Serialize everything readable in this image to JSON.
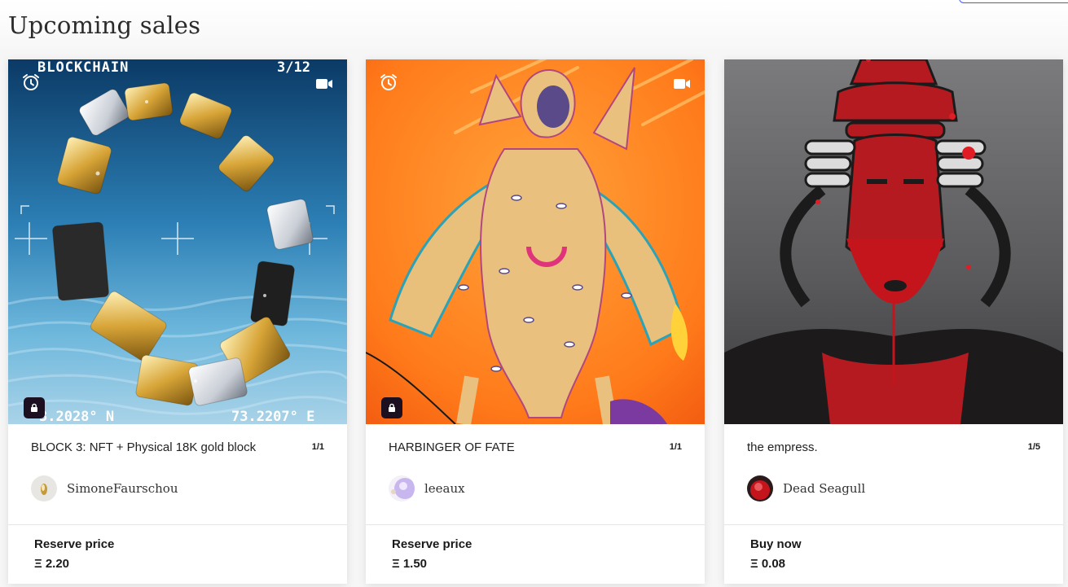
{
  "section": {
    "title": "Upcoming sales"
  },
  "cards": [
    {
      "art_text": {
        "top_left": "BLOCKCHAIN",
        "top_right": "3/12",
        "bottom_left": "3.2028° N",
        "bottom_right": "73.2207° E"
      },
      "title": "BLOCK 3: NFT + Physical 18K gold block",
      "edition": "1/1",
      "creator": "SimoneFaurschou",
      "price_label": "Reserve price",
      "price_value": "Ξ 2.20",
      "icons": [
        "alarm-icon",
        "video-icon",
        "lock-icon"
      ]
    },
    {
      "title": "HARBINGER OF FATE",
      "edition": "1/1",
      "creator": "leeaux",
      "price_label": "Reserve price",
      "price_value": "Ξ 1.50",
      "icons": [
        "alarm-icon",
        "video-icon",
        "lock-icon"
      ]
    },
    {
      "title": "the empress.",
      "edition": "1/5",
      "creator": "Dead Seagull",
      "price_label": "Buy now",
      "price_value": "Ξ 0.08",
      "icons": []
    }
  ],
  "colors": {
    "accent": "#3d5afe",
    "lock_badge": "#1b0f20",
    "sea": "#4f9fc8",
    "orange": "#ff7a1a",
    "crimson": "#c4141c"
  }
}
